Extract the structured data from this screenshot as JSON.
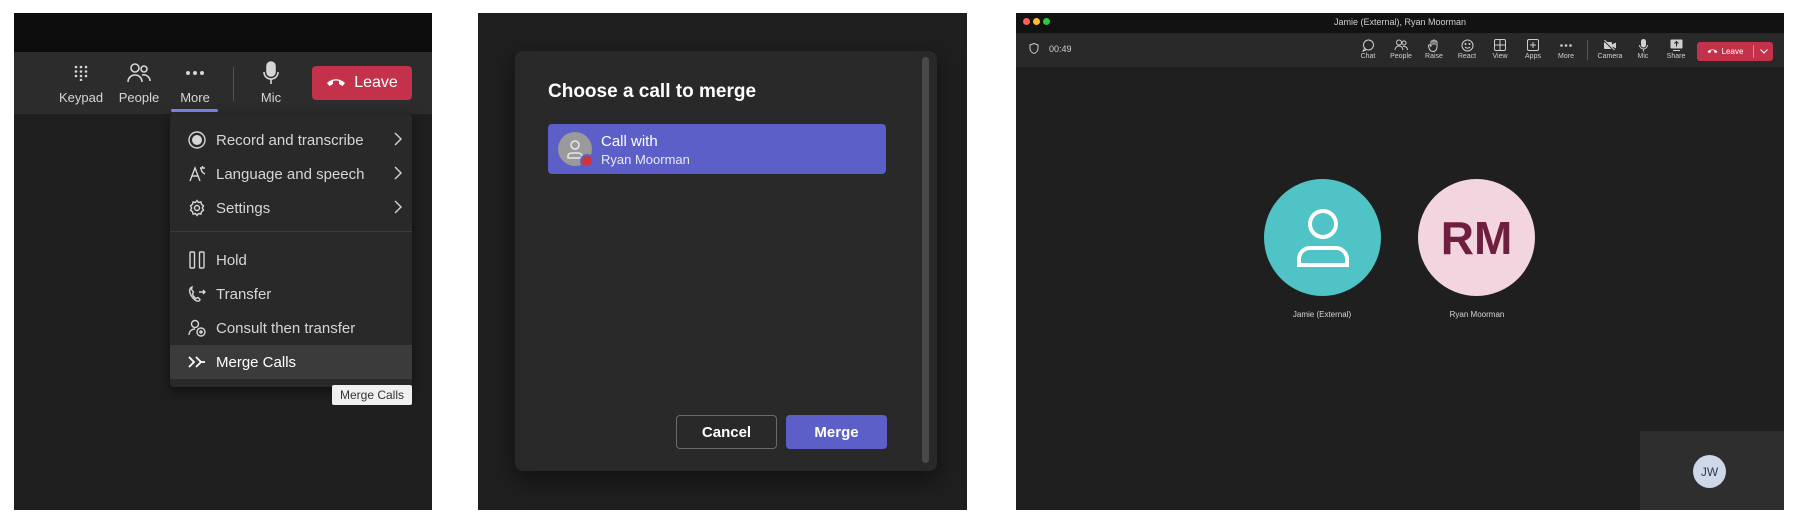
{
  "panel1": {
    "toolbar": {
      "keypad_label": "Keypad",
      "people_label": "People",
      "more_label": "More",
      "mic_label": "Mic",
      "leave_label": "Leave"
    },
    "menu": {
      "items": [
        {
          "label": "Record and transcribe",
          "icon": "record-icon",
          "submenu": true
        },
        {
          "label": "Language and speech",
          "icon": "language-icon",
          "submenu": true
        },
        {
          "label": "Settings",
          "icon": "gear-icon",
          "submenu": true
        },
        {
          "label": "Hold",
          "icon": "pause-icon",
          "submenu": false
        },
        {
          "label": "Transfer",
          "icon": "transfer-icon",
          "submenu": false
        },
        {
          "label": "Consult then transfer",
          "icon": "consult-icon",
          "submenu": false
        },
        {
          "label": "Merge Calls",
          "icon": "merge-icon",
          "submenu": false,
          "active": true
        }
      ]
    },
    "tooltip": "Merge Calls"
  },
  "panel2": {
    "dialog_title": "Choose a call to merge",
    "call_item": {
      "line1": "Call with",
      "line2": "Ryan Moorman"
    },
    "cancel_label": "Cancel",
    "merge_label": "Merge"
  },
  "panel3": {
    "window_title": "Jamie (External), Ryan Moorman",
    "timer": "00:49",
    "toolbar": {
      "chat": "Chat",
      "people": "People",
      "raise": "Raise",
      "react": "React",
      "view": "View",
      "apps": "Apps",
      "more": "More",
      "camera": "Camera",
      "mic": "Mic",
      "share": "Share",
      "leave": "Leave"
    },
    "participants": [
      {
        "name": "Jamie (External)",
        "initials": ""
      },
      {
        "name": "Ryan Moorman",
        "initials": "RM"
      }
    ],
    "self_initials": "JW"
  },
  "colors": {
    "accent": "#5b5fc7",
    "leave_red": "#c4314b",
    "avatar_teal": "#4fc3c6",
    "avatar_pink": "#f3d5df"
  }
}
